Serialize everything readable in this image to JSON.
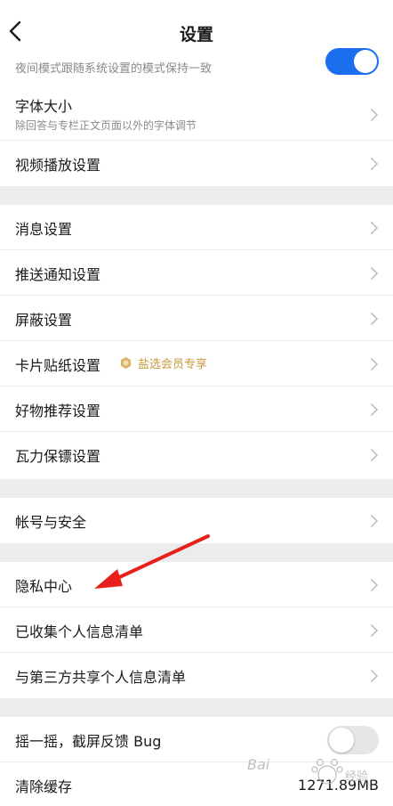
{
  "header": {
    "title": "设置"
  },
  "night_mode": {
    "description": "夜间模式跟随系统设置的模式保持一致",
    "enabled": true
  },
  "group1": {
    "font_size": {
      "label": "字体大小",
      "sub": "除回答与专栏正文页面以外的字体调节"
    },
    "video": {
      "label": "视频播放设置"
    }
  },
  "group2": {
    "items": [
      {
        "label": "消息设置"
      },
      {
        "label": "推送通知设置"
      },
      {
        "label": "屏蔽设置"
      },
      {
        "label": "卡片贴纸设置",
        "badge": "盐选会员专享"
      },
      {
        "label": "好物推荐设置"
      },
      {
        "label": "瓦力保镖设置"
      }
    ]
  },
  "group3": {
    "items": [
      {
        "label": "帐号与安全"
      }
    ]
  },
  "group4": {
    "items": [
      {
        "label": "隐私中心"
      },
      {
        "label": "已收集个人信息清单"
      },
      {
        "label": "与第三方共享个人信息清单"
      }
    ]
  },
  "group5": {
    "shake": {
      "label": "摇一摇，截屏反馈 Bug",
      "enabled": false
    },
    "cache": {
      "label": "清除缓存",
      "value": "1271.89MB"
    }
  },
  "colors": {
    "accent": "#1b6fef",
    "badge_gold": "#c79a3b",
    "annotation_arrow": "#e8201c"
  },
  "watermark": {
    "text": "Baidu经验"
  }
}
